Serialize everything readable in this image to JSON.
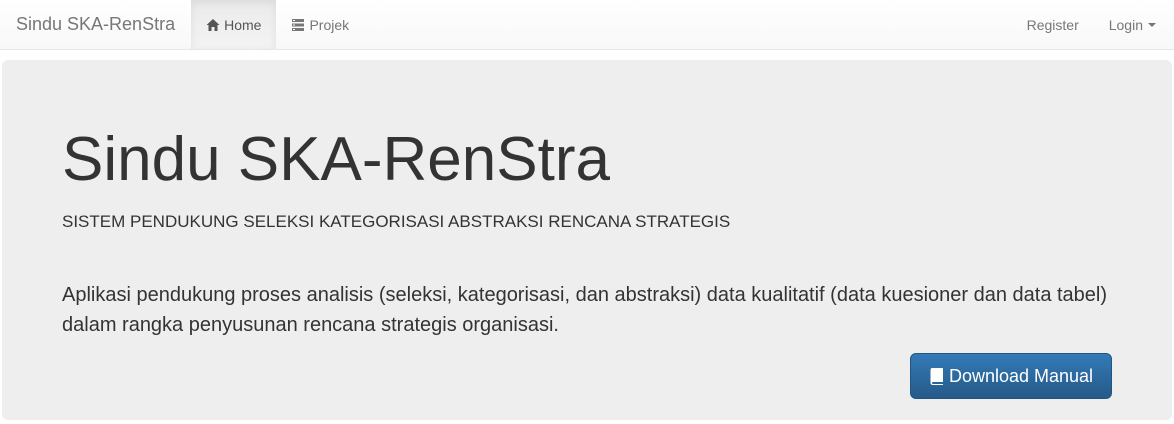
{
  "navbar": {
    "brand": "Sindu SKA-RenStra",
    "items": [
      {
        "label": "Home",
        "icon": "home-icon",
        "active": true
      },
      {
        "label": "Projek",
        "icon": "list-icon",
        "active": false
      }
    ],
    "right_items": [
      {
        "label": "Register"
      },
      {
        "label": "Login",
        "dropdown": true
      }
    ]
  },
  "jumbotron": {
    "title": "Sindu SKA-RenStra",
    "subtitle": "SISTEM PENDUKUNG SELEKSI KATEGORISASI ABSTRAKSI RENCANA STRATEGIS",
    "description": "Aplikasi pendukung proses analisis (seleksi, kategorisasi, dan abstraksi) data kualitatif (data kuesioner dan data tabel) dalam rangka penyusunan rencana strategis organisasi.",
    "button_label": "Download Manual",
    "button_icon": "book-icon"
  },
  "colors": {
    "primary_button": "#337ab7",
    "jumbotron_bg": "#eeeeee",
    "nav_text": "#777777"
  }
}
